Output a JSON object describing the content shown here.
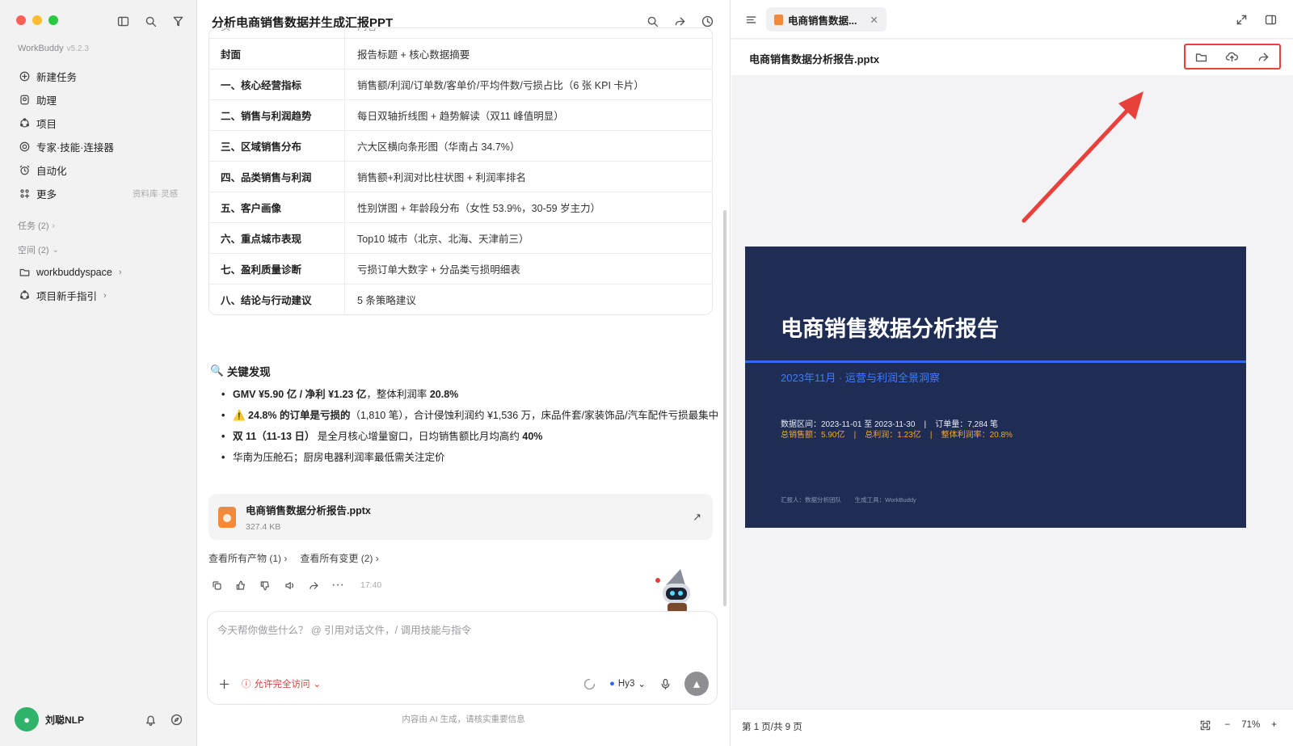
{
  "sidebar": {
    "brand": "WorkBuddy",
    "version": "v5.2.3",
    "nav": [
      {
        "label": "新建任务",
        "icon": "plus-circle-icon"
      },
      {
        "label": "助理",
        "icon": "assistant-icon"
      },
      {
        "label": "项目",
        "icon": "project-icon"
      },
      {
        "label": "专家·技能·连接器",
        "icon": "expert-icon"
      },
      {
        "label": "自动化",
        "icon": "automation-icon"
      },
      {
        "label": "更多",
        "icon": "more-grid-icon",
        "hint": "资料库·灵感"
      }
    ],
    "tasks_label": "任务 (2)",
    "spaces_label": "空间 (2)",
    "spaces": [
      {
        "label": "workbuddyspace"
      },
      {
        "label": "项目新手指引"
      }
    ],
    "user": "刘聪NLP",
    "avatar_colors": {
      "bg": "#2fb36b"
    }
  },
  "chat": {
    "title": "分析电商销售数据并生成汇报PPT",
    "table_head": [
      "页",
      "内容"
    ],
    "table": [
      [
        "封面",
        "报告标题 + 核心数据摘要"
      ],
      [
        "一、核心经营指标",
        "销售额/利润/订单数/客单价/平均件数/亏损占比（6 张 KPI 卡片）"
      ],
      [
        "二、销售与利润趋势",
        "每日双轴折线图 + 趋势解读（双11 峰值明显）"
      ],
      [
        "三、区域销售分布",
        "六大区横向条形图（华南占 34.7%）"
      ],
      [
        "四、品类销售与利润",
        "销售额+利润对比柱状图 + 利润率排名"
      ],
      [
        "五、客户画像",
        "性别饼图 + 年龄段分布（女性 53.9%，30-59 岁主力）"
      ],
      [
        "六、重点城市表现",
        "Top10 城市（北京、北海、天津前三）"
      ],
      [
        "七、盈利质量诊断",
        "亏损订单大数字 + 分品类亏损明细表"
      ],
      [
        "八、结论与行动建议",
        "5 条策略建议"
      ]
    ],
    "findings_title": "关键发现",
    "findings": [
      {
        "bold": "GMV ¥5.90 亿 / 净利 ¥1.23 亿",
        "text": "，整体利润率 ",
        "bold2": "20.8%",
        "tail": ""
      },
      {
        "bold": "⚠️ 24.8% 的订单是亏损的",
        "text": "（1,810 笔），合计侵蚀利润约 ¥1,536 万，床品件套/家装饰品/汽车配件亏损最集中",
        "bold2": "",
        "tail": ""
      },
      {
        "bold": "双 11（11-13 日）",
        "text": " 是全月核心增量窗口，日均销售额比月均高约 ",
        "bold2": "40%",
        "tail": ""
      },
      {
        "bold": "",
        "text": "华南为压舱石；厨房电器利润率最低需关注定价",
        "bold2": "",
        "tail": ""
      }
    ],
    "file": {
      "name": "电商销售数据分析报告.pptx",
      "size": "327.4 KB"
    },
    "links": [
      "查看所有产物 (1)",
      "查看所有变更 (2)"
    ],
    "time": "17:40",
    "placeholder": "今天帮你做些什么？ @ 引用对话文件，/ 调用技能与指令",
    "permission": "允许完全访问",
    "model": "Hy3",
    "footnote": "内容由 AI 生成，请核实重要信息"
  },
  "preview": {
    "tab": "电商销售数据...",
    "file": "电商销售数据分析报告.pptx",
    "slide": {
      "title": "电商销售数据分析报告",
      "subtitle": "2023年11月 · 运营与利润全景洞察",
      "line1": "数据区间：2023-11-01 至 2023-11-30    |    订单量：7,284 笔",
      "line2": "总销售额：5.90亿    |    总利润：1.23亿    |    整体利润率：20.8%",
      "footer": "汇报人：数据分析团队        生成工具：WorkBuddy"
    },
    "page": "第 1 页/共 9 页",
    "zoom": "71%"
  },
  "colors": {
    "accent": "#e8403a",
    "slide_bg": "#1f2d55",
    "slide_blue": "#2f6df0",
    "slide_orange": "#f5a623"
  }
}
